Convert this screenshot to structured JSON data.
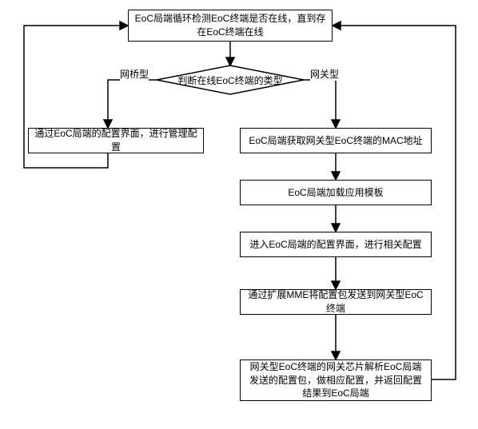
{
  "chart_data": {
    "type": "diagram",
    "title": "",
    "nodes": [
      {
        "id": "start",
        "shape": "rect",
        "text": "EoC局端循环检测EoC终端是否在线，\n直到存在EoC终端在线"
      },
      {
        "id": "decision",
        "shape": "diamond",
        "text": "判断在线EoC终端的类型"
      },
      {
        "id": "bridge",
        "shape": "rect",
        "text": "通过EoC局端的配置界面，进行管理配置"
      },
      {
        "id": "gw1",
        "shape": "rect",
        "text": "EoC局端获取网关型EoC终端的MAC地址"
      },
      {
        "id": "gw2",
        "shape": "rect",
        "text": "EoC局端加载应用模板"
      },
      {
        "id": "gw3",
        "shape": "rect",
        "text": "进入EoC局端的配置界面，进行相关配置"
      },
      {
        "id": "gw4",
        "shape": "rect",
        "text": "通过扩展MME将配置包发送到网关型EoC终端"
      },
      {
        "id": "gw5",
        "shape": "rect",
        "text": "网关型EoC终端的网关芯片解析EoC局端发送的配置包，做相应配置，并返回配置结果到EoC局端"
      }
    ],
    "edges": [
      {
        "from": "start",
        "to": "decision",
        "label": ""
      },
      {
        "from": "decision",
        "to": "bridge",
        "label": "网桥型"
      },
      {
        "from": "decision",
        "to": "gw1",
        "label": "网关型"
      },
      {
        "from": "gw1",
        "to": "gw2",
        "label": ""
      },
      {
        "from": "gw2",
        "to": "gw3",
        "label": ""
      },
      {
        "from": "gw3",
        "to": "gw4",
        "label": ""
      },
      {
        "from": "gw4",
        "to": "gw5",
        "label": ""
      },
      {
        "from": "bridge",
        "to": "start",
        "label": ""
      },
      {
        "from": "gw5",
        "to": "start",
        "label": ""
      }
    ]
  },
  "labels": {
    "bridge_branch": "网桥型",
    "gateway_branch": "网关型"
  },
  "boxes": {
    "start": "EoC局端循环检测EoC终端是否在线，直到存在EoC终端在线",
    "decision": "判断在线EoC终端的类型",
    "bridge": "通过EoC局端的配置界面，进行管理配置",
    "gw1": "EoC局端获取网关型EoC终端的MAC地址",
    "gw2": "EoC局端加载应用模板",
    "gw3": "进入EoC局端的配置界面，进行相关配置",
    "gw4": "通过扩展MME将配置包发送到网关型EoC终端",
    "gw5": "网关型EoC终端的网关芯片解析EoC局端发送的配置包，做相应配置，并返回配置结果到EoC局端"
  }
}
